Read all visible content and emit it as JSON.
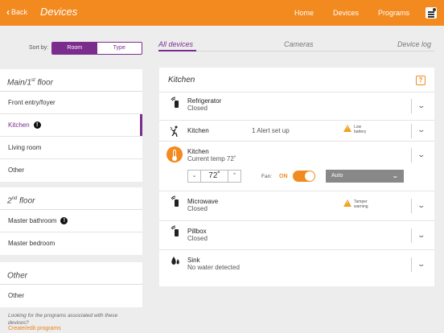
{
  "header": {
    "back_label": "Back",
    "title": "Devices",
    "nav": [
      "Home",
      "Devices",
      "Programs"
    ]
  },
  "sort": {
    "label": "Sort by:",
    "options": [
      "Room",
      "Type"
    ],
    "selected": "Room"
  },
  "tabs": [
    "All devices",
    "Cameras",
    "Device log"
  ],
  "groups": [
    {
      "title": "Main/1",
      "title_sup": "st",
      "title_rest": " floor",
      "items": [
        "Front entry/foyer",
        "Kitchen",
        "Living room",
        "Other"
      ]
    },
    {
      "title": "2",
      "title_sup": "nd",
      "title_rest": " floor",
      "items": [
        "Master bathroom",
        "Master bedroom"
      ]
    },
    {
      "title": "Other",
      "title_sup": "",
      "title_rest": "",
      "items": [
        "Other"
      ]
    }
  ],
  "footer": {
    "note": "Looking for the programs associated with these devices?",
    "link": "Create/edit programs"
  },
  "card": {
    "title": "Kitchen",
    "help": "?",
    "devices": [
      {
        "name": "Refrigerator",
        "status": "Closed"
      },
      {
        "name": "Kitchen",
        "status": "1 Alert set up",
        "warning": "Low battery"
      },
      {
        "name": "Kitchen",
        "status": "Current temp 72˚"
      },
      {
        "name": "Microwave",
        "status": "Closed",
        "warning": "Tamper warning"
      },
      {
        "name": "Pillbox",
        "status": "Closed"
      },
      {
        "name": "Sink",
        "status": "No water detected"
      }
    ],
    "thermostat": {
      "setpoint": "72˚",
      "fan_label": "Fan:",
      "fan_state": "ON",
      "mode": "Auto"
    }
  },
  "colors": {
    "brand": "#f28a20",
    "accent": "#7b2d8e"
  }
}
